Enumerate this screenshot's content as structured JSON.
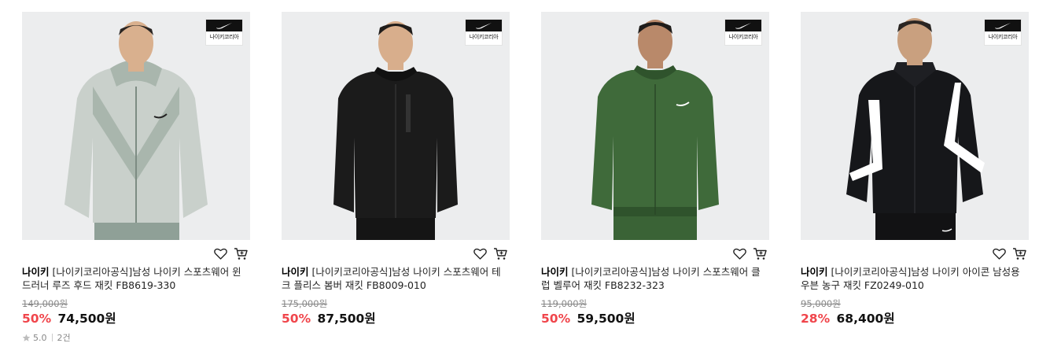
{
  "products": [
    {
      "brand": "나이키",
      "name": "[나이키코리아공식]남성 나이키 스포츠웨어 윈드러너 루즈 후드 재킷 FB8619-330",
      "original_price": "149,000원",
      "discount": "50%",
      "price": "74,500원",
      "badge_text": "나이키코리아",
      "rating": "5.0",
      "reviews": "2건",
      "jacket_color": "#c9d0cb",
      "accent_color": "#a9b6ad",
      "pants_color": "#8fa097"
    },
    {
      "brand": "나이키",
      "name": "[나이키코리아공식]남성 나이키 스포츠웨어 테크 플리스 봄버 재킷 FB8009-010",
      "original_price": "175,000원",
      "discount": "50%",
      "price": "87,500원",
      "badge_text": "나이키코리아",
      "jacket_color": "#1b1b1b",
      "accent_color": "#111111",
      "pants_color": "#151515"
    },
    {
      "brand": "나이키",
      "name": "[나이키코리아공식]남성 나이키 스포츠웨어 클럽 벨루어 재킷 FB8232-323",
      "original_price": "119,000원",
      "discount": "50%",
      "price": "59,500원",
      "badge_text": "나이키코리아",
      "jacket_color": "#3f6a3a",
      "accent_color": "#2f532c",
      "pants_color": "#3a6336"
    },
    {
      "brand": "나이키",
      "name": "[나이키코리아공식]남성 나이키 아이콘 남성용 우븐 농구 재킷 FZ0249-010",
      "original_price": "95,000원",
      "discount": "28%",
      "price": "68,400원",
      "badge_text": "나이키코리아",
      "jacket_color": "#16171a",
      "accent_color": "#ffffff",
      "pants_color": "#121214"
    }
  ]
}
